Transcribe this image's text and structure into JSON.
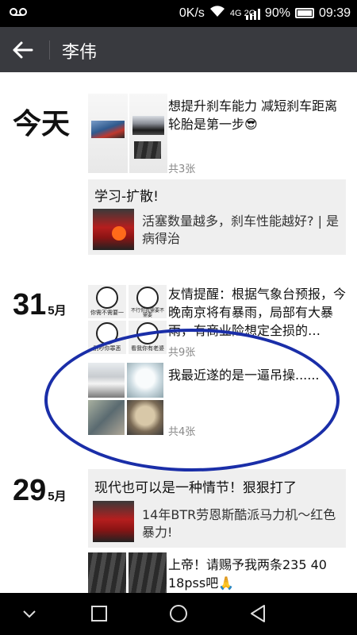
{
  "status_bar": {
    "left_icon": "voicemail-icon",
    "speed": "0K/s",
    "network": "4G 2G",
    "battery": "90%",
    "time": "09:39"
  },
  "header": {
    "title": "李伟"
  },
  "groups": [
    {
      "date_label": "今天",
      "posts": [
        {
          "text": "想提升刹车能力 减短刹车距离 轮胎是第一步😎",
          "count": "共3张"
        }
      ],
      "share": {
        "head": "学习-扩散!",
        "text": "活塞数量越多，刹车性能越好? | 是病得治"
      }
    },
    {
      "day": "31",
      "month": "5月",
      "posts": [
        {
          "text": "友情提醒：根据气象台预报，今晚南京将有暴雨，局部有大暴雨，有商业险想定全损的…",
          "count": "共9张"
        },
        {
          "text": "我最近遂的是一逼吊操......",
          "count": "共4张"
        }
      ],
      "meme_captions": [
        "你需不需要一",
        "不行你我需要不需要",
        "别吵你罪恶",
        "看我你有老婆"
      ]
    },
    {
      "day": "29",
      "month": "5月",
      "share": {
        "head": "现代也可以是一种情节！狠狠打了",
        "text": "14年BTR劳恩斯酷派马力机～红色暴力!"
      },
      "posts": [
        {
          "text": "上帝！请赐予我两条235 40 18pss吧🙏"
        }
      ]
    }
  ]
}
